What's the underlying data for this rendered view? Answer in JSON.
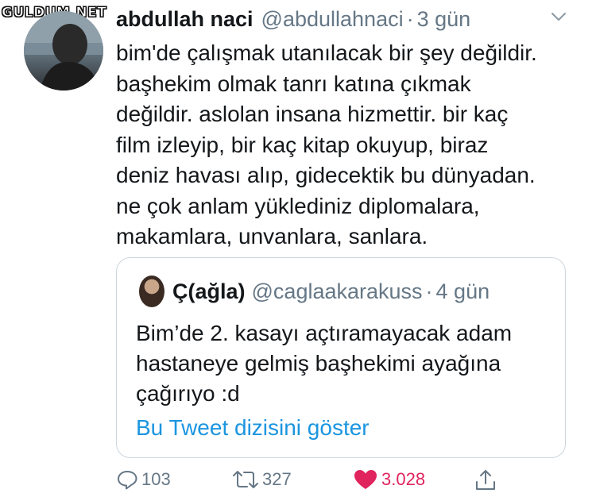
{
  "watermark": "GULDUM.NET",
  "tweet": {
    "author_name": "abdullah naci",
    "author_handle": "@abdullahnaci",
    "separator": "·",
    "time": "3 gün",
    "lines": [
      "bim'de çalışmak utanılacak bir şey değildir.",
      "başhekim olmak tanrı katına çıkmak",
      "değildir. aslolan insana hizmettir. bir kaç",
      "film izleyip, bir kaç kitap okuyup, biraz",
      "deniz havası alıp, gidecektik bu dünyadan.",
      "ne çok anlam yüklediniz diplomalara,",
      "makamlara, unvanlara, sanlara."
    ]
  },
  "quoted": {
    "author_name": "Ç(ağla)",
    "author_handle": "@caglaakarakuss",
    "separator": "·",
    "time": "4 gün",
    "lines": [
      "Bim’de 2. kasayı açtıramayacak adam",
      "hastaneye gelmiş başhekimi ayağına",
      "çağırıyo :d"
    ],
    "thread_link": "Bu Tweet dizisini göster"
  },
  "actions": {
    "replies": "103",
    "retweets": "327",
    "likes": "3.028",
    "icons": [
      "reply-icon",
      "retweet-icon",
      "heart-icon",
      "share-icon"
    ]
  },
  "colors": {
    "text": "#14171a",
    "secondary": "#657786",
    "link": "#1b95e0",
    "like": "#e0245e",
    "border": "#ccd6dd"
  }
}
